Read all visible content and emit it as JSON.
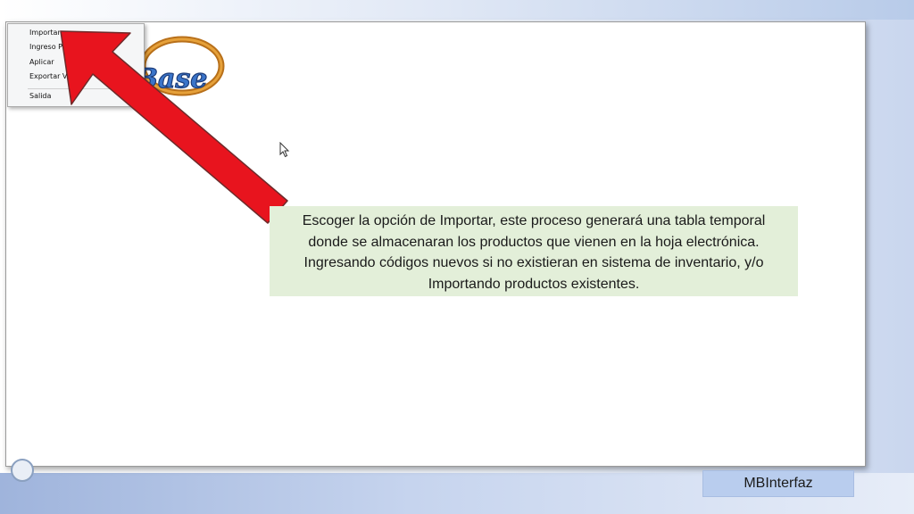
{
  "context_menu": {
    "items": [
      {
        "label": "Importar"
      },
      {
        "label": "Ingreso P"
      },
      {
        "label": "Aplicar"
      },
      {
        "label": "Exportar V"
      },
      {
        "label": "Salida"
      }
    ]
  },
  "logo": {
    "text": "Base"
  },
  "callout": {
    "lines": [
      "Escoger la opción de Importar, este proceso generará una tabla temporal",
      "donde se almacenaran los productos que vienen en la hoja electrónica.",
      "Ingresando códigos nuevos si no existieran en sistema de inventario,  y/o",
      "Importando productos existentes."
    ]
  },
  "footer": {
    "label": "MBInterfaz"
  },
  "colors": {
    "arrow": "#e8141e",
    "callout_bg": "#e3efd9",
    "footer_bg": "#b9cdee"
  }
}
